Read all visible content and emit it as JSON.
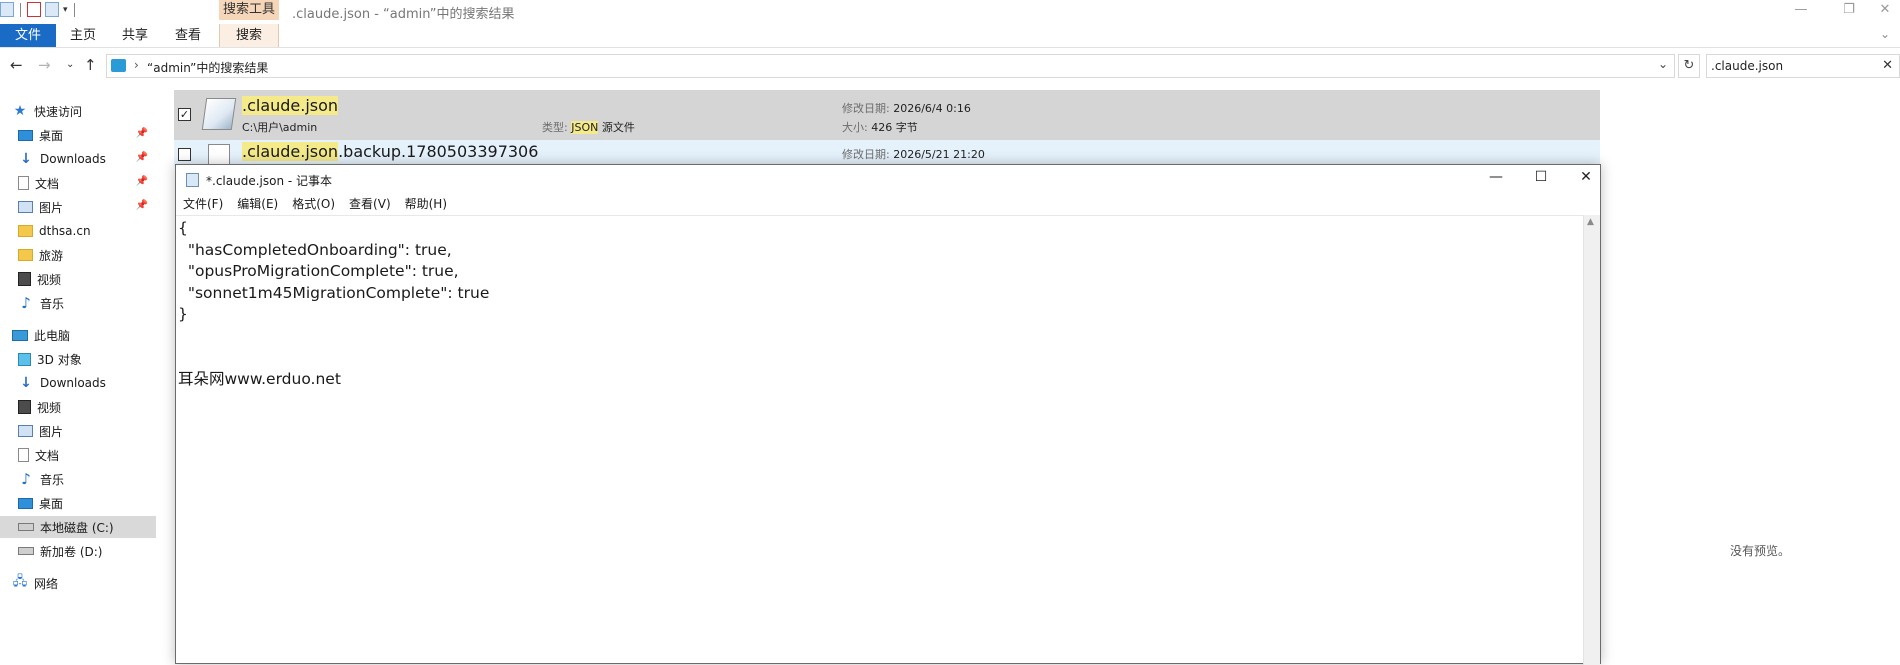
{
  "explorer": {
    "title": ".claude.json - “admin”中的搜索结果",
    "context_tab_label": "搜索工具",
    "ribbon_tabs": [
      "文件",
      "主页",
      "共享",
      "查看",
      "搜索"
    ],
    "address_path": "“admin”中的搜索结果",
    "search_value": ".claude.json",
    "no_preview": "没有预览。"
  },
  "nav": {
    "quick_access": "快速访问",
    "quick_items": [
      {
        "label": "桌面",
        "icon": "desktop-icon"
      },
      {
        "label": "Downloads",
        "icon": "downloads-icon"
      },
      {
        "label": "文档",
        "icon": "documents-icon"
      },
      {
        "label": "图片",
        "icon": "pictures-icon"
      },
      {
        "label": "dthsa.cn",
        "icon": "folder-icon"
      },
      {
        "label": "旅游",
        "icon": "folder-icon"
      },
      {
        "label": "视频",
        "icon": "videos-icon"
      },
      {
        "label": "音乐",
        "icon": "music-icon"
      }
    ],
    "this_pc": "此电脑",
    "pc_items": [
      {
        "label": "3D 对象",
        "icon": "3d-objects-icon"
      },
      {
        "label": "Downloads",
        "icon": "downloads-icon"
      },
      {
        "label": "视频",
        "icon": "videos-icon"
      },
      {
        "label": "图片",
        "icon": "pictures-icon"
      },
      {
        "label": "文档",
        "icon": "documents-icon"
      },
      {
        "label": "音乐",
        "icon": "music-icon"
      },
      {
        "label": "桌面",
        "icon": "desktop-icon"
      },
      {
        "label": "本地磁盘 (C:)",
        "icon": "drive-icon"
      },
      {
        "label": "新加卷 (D:)",
        "icon": "drive-icon"
      }
    ],
    "network": "网络"
  },
  "files": [
    {
      "name_highlight": ".claude.json",
      "name_rest": "",
      "path": "C:\\用户\\admin",
      "type_label": "类型:",
      "type_highlight": "JSON",
      "type_rest": " 源文件",
      "modified_label": "修改日期:",
      "modified": "2026/6/4 0:16",
      "size_label": "大小:",
      "size": "426 字节"
    },
    {
      "name_highlight": ".claude.json",
      "name_rest": ".backup.1780503397306",
      "modified_label": "修改日期:",
      "modified": "2026/5/21 21:20"
    }
  ],
  "notepad": {
    "title": "*.claude.json - 记事本",
    "menus": [
      "文件(F)",
      "编辑(E)",
      "格式(O)",
      "查看(V)",
      "帮助(H)"
    ],
    "content": "{\n  \"hasCompletedOnboarding\": true,\n  \"opusProMigrationComplete\": true,\n  \"sonnet1m45MigrationComplete\": true\n}\n\n\n耳朵网www.erduo.net"
  }
}
